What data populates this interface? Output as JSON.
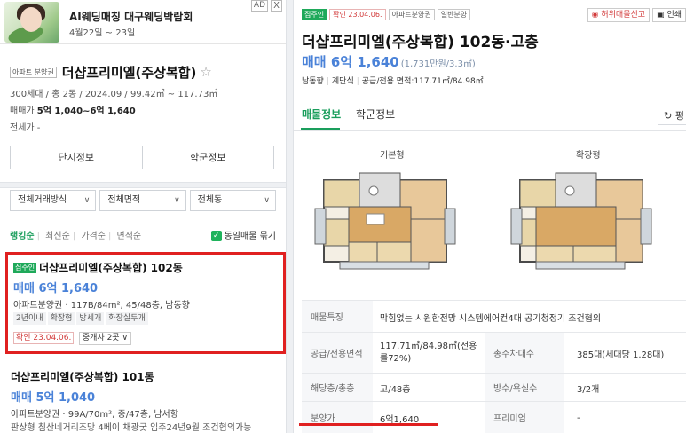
{
  "ad": {
    "title": "AI웨딩매칭 대구웨딩박람회",
    "sub": "4월22일 ~ 23일",
    "badge": "AD",
    "close": "X"
  },
  "complex": {
    "type_tag": "아파트 분양권",
    "name": "더샵프리미엘(주상복합)",
    "star": "☆",
    "info": "300세대 / 총 2동 / 2024.09 / 99.42㎡ ~ 117.73㎡",
    "price_label": "매매가",
    "price_value": "5억 1,040~6억 1,640",
    "lease_label": "전세가",
    "lease_value": "-",
    "btn_info": "단지정보",
    "btn_school": "학군정보"
  },
  "filters": {
    "trade": "전체거래방식",
    "area": "전체면적",
    "dong": "전체동"
  },
  "sort": {
    "items": [
      "랭킹순",
      "최신순",
      "가격순",
      "면적순"
    ],
    "active": 0,
    "bundle_label": "동일매물 묶기",
    "check": "✓"
  },
  "listings": [
    {
      "move_tag": "집주인",
      "name": "더샵프리미엘(주상복합) 102동",
      "price": "매매 6억 1,640",
      "spec": "아파트분양권 · 117B/84m², 45/48층, 남동향",
      "chips": [
        "2년이내",
        "확장형",
        "방세개",
        "화장실두개"
      ],
      "confirm": "확인 23.04.06.",
      "broker": "중개사 2곳"
    },
    {
      "name": "더샵프리미엘(주상복합) 101동",
      "price": "매매 5억 1,040",
      "spec": "아파트분양권 · 99A/70m², 중/47층, 남서향",
      "desc": "판상형 침산네거리조망 4베이 채광굿 입주24년9월 조건협의가능"
    }
  ],
  "detail": {
    "tag_move": "집주인",
    "tag_confirm": "확인 23.04.06.",
    "tag_type": "아파트분양권",
    "tag_general": "일반분양",
    "fake_report": "허위매물신고",
    "print": "인쇄",
    "title": "더샵프리미엘(주상복합) 102동·고층",
    "price": "매매 6억 1,640",
    "price_per": "(1,731만원/3.3㎡)",
    "spec": [
      "남동향",
      "계단식",
      "공급/전용 면적:117.71㎡/84.98㎡"
    ],
    "tabs": [
      "매물정보",
      "학군정보"
    ],
    "tab_right": "평",
    "plan_basic": "기본형",
    "plan_ext": "확장형",
    "rows": {
      "feature_label": "매물특징",
      "feature_value": "막힘없는 시원한전망 시스템에어컨4대 공기청정기 조건협의",
      "area_label": "공급/전용면적",
      "area_value": "117.71㎡/84.98㎡(전용률72%)",
      "households_label": "총주차대수",
      "households_value": "385대(세대당 1.28대)",
      "floor_label": "해당층/총층",
      "floor_value": "고/48층",
      "rooms_label": "방수/욕실수",
      "rooms_value": "3/2개",
      "sale_label": "분양가",
      "sale_value": "6억1,640",
      "premium_label": "프리미엄",
      "premium_value": "-"
    }
  },
  "colors": {
    "green": "#1a9e5c",
    "blue_price": "#4a82d8",
    "red_highlight": "#e02020"
  }
}
